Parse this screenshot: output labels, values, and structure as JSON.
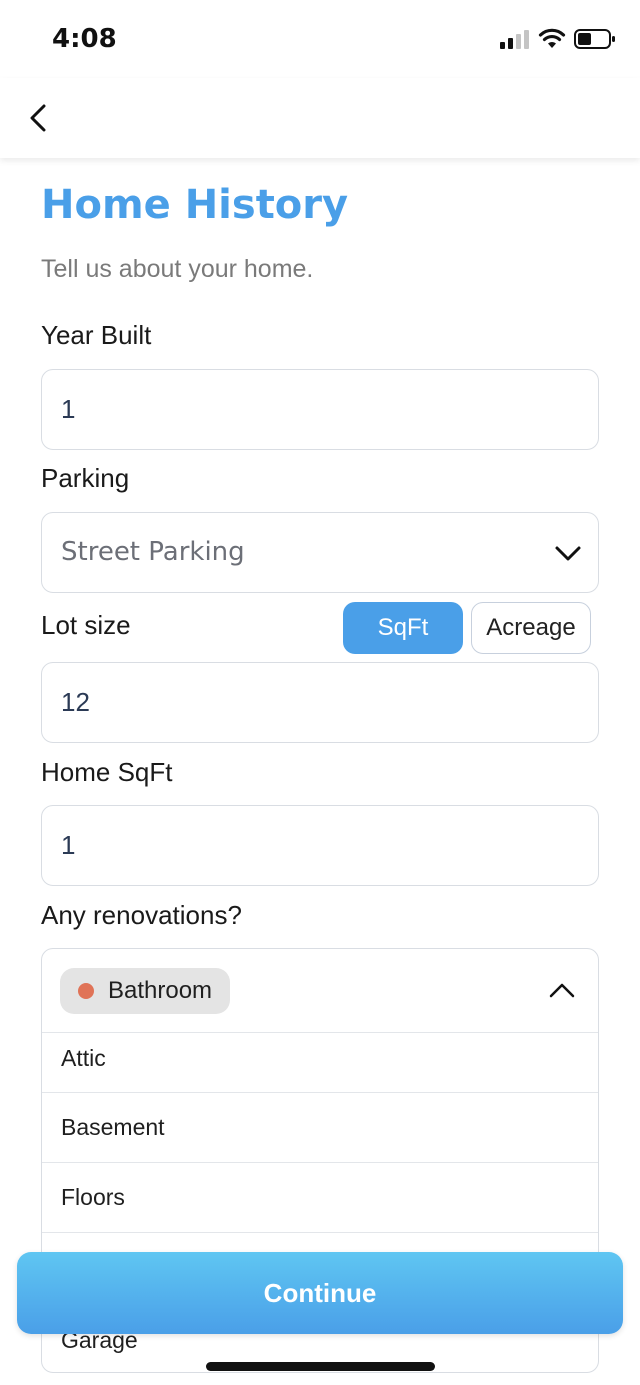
{
  "status_bar": {
    "time": "4:08",
    "signal_icon": "cellular-signal-icon",
    "wifi_icon": "wifi-icon",
    "battery_icon": "battery-icon"
  },
  "nav": {
    "back_icon": "chevron-left-icon"
  },
  "header": {
    "title": "Home History",
    "subtitle": "Tell us about your home."
  },
  "form": {
    "year_built": {
      "label": "Year Built",
      "value": "1"
    },
    "parking": {
      "label": "Parking",
      "value": "Street Parking",
      "icon": "chevron-down-icon"
    },
    "lot_size": {
      "label": "Lot size",
      "value": "12",
      "units": [
        "SqFt",
        "Acreage"
      ],
      "selected_unit": "SqFt"
    },
    "home_sqft": {
      "label": "Home SqFt",
      "value": "1"
    },
    "renovations": {
      "label": "Any renovations?",
      "selected": [
        {
          "label": "Bathroom",
          "color": "#e07357"
        }
      ],
      "toggle_icon": "chevron-up-icon",
      "options": [
        "Attic",
        "Basement",
        "Floors",
        "Garage"
      ]
    }
  },
  "actions": {
    "continue_label": "Continue"
  },
  "colors": {
    "accent": "#4a9fe8",
    "gradient_top": "#5fc6f2",
    "chip_dot": "#e07357"
  }
}
